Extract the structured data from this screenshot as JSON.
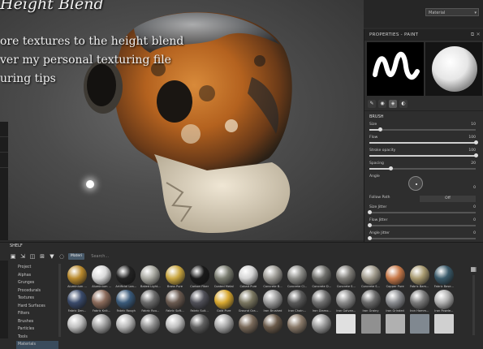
{
  "overlay": {
    "title": "Height Blend",
    "lines": [
      "ore textures to the height blend",
      "ver my personal texturing file",
      "uring tips"
    ]
  },
  "top_bar": {
    "viewport_mode": "Material"
  },
  "properties_panel": {
    "title": "PROPERTIES - PAINT",
    "section_title": "BRUSH",
    "params": [
      {
        "label": "Size",
        "value": "10",
        "fraction": 0.1
      },
      {
        "label": "Flow",
        "value": "100",
        "fraction": 1.0
      },
      {
        "label": "Stroke opacity",
        "value": "100",
        "fraction": 1.0
      },
      {
        "label": "Spacing",
        "value": "20",
        "fraction": 0.2
      }
    ],
    "angle_label": "Angle",
    "angle_value": "0",
    "follow_path_label": "Follow Path",
    "follow_path_value": "Off",
    "jitter_params": [
      {
        "label": "Size Jitter",
        "value": "0",
        "fraction": 0.0
      },
      {
        "label": "Flow Jitter",
        "value": "0",
        "fraction": 0.0
      },
      {
        "label": "Angle Jitter",
        "value": "0",
        "fraction": 0.0
      },
      {
        "label": "Position Jitter",
        "value": "0",
        "fraction": 0.0
      }
    ]
  },
  "shelf": {
    "title": "SHELF",
    "filter_tag": "Materi",
    "search_placeholder": "Search...",
    "categories": [
      {
        "label": "Project",
        "selected": false
      },
      {
        "label": "Alphas",
        "selected": false
      },
      {
        "label": "Grunges",
        "selected": false
      },
      {
        "label": "Procedurals",
        "selected": false
      },
      {
        "label": "Textures",
        "selected": false
      },
      {
        "label": "Hard Surfaces",
        "selected": false
      },
      {
        "label": "Filters",
        "selected": false
      },
      {
        "label": "Brushes",
        "selected": false
      },
      {
        "label": "Particles",
        "selected": false
      },
      {
        "label": "Tools",
        "selected": false
      },
      {
        "label": "Materials",
        "selected": true
      }
    ],
    "materials_row1": [
      {
        "label": "Aluminium ...",
        "color": "#b98a2e",
        "shape": "sphere"
      },
      {
        "label": "Aluminium ...",
        "color": "#d9d9d9",
        "shape": "sphere"
      },
      {
        "label": "Artificial Lea...",
        "color": "#222222",
        "shape": "sphere"
      },
      {
        "label": "Baked Light...",
        "color": "#a8a8a0",
        "shape": "sphere"
      },
      {
        "label": "Brass Pure",
        "color": "#c9a640",
        "shape": "sphere"
      },
      {
        "label": "Carbon Fiber",
        "color": "#1a1a1a",
        "shape": "sphere"
      },
      {
        "label": "Coated Metal",
        "color": "#7a7c70",
        "shape": "sphere"
      },
      {
        "label": "Cobalt Pure",
        "color": "#d4d4d4",
        "shape": "sphere"
      },
      {
        "label": "Concrete B...",
        "color": "#9c9a94",
        "shape": "sphere"
      },
      {
        "label": "Concrete Cl...",
        "color": "#8c8c88",
        "shape": "sphere"
      },
      {
        "label": "Concrete D...",
        "color": "#6e6e6a",
        "shape": "sphere"
      },
      {
        "label": "Concrete S...",
        "color": "#7f7d78",
        "shape": "sphere"
      },
      {
        "label": "Concrete S...",
        "color": "#a09a8c",
        "shape": "sphere"
      },
      {
        "label": "Copper Pure",
        "color": "#c87a4a",
        "shape": "sphere"
      },
      {
        "label": "Fabric Bam...",
        "color": "#a89a70",
        "shape": "sphere"
      },
      {
        "label": "Fabric Base...",
        "color": "#3a5a6a",
        "shape": "sphere"
      }
    ],
    "materials_row2": [
      {
        "label": "Fabric Den...",
        "color": "#3a4a6a",
        "shape": "sphere"
      },
      {
        "label": "Fabric Knit...",
        "color": "#8a6a5a",
        "shape": "sphere"
      },
      {
        "label": "Fabric Rough",
        "color": "#3a5a7a",
        "shape": "sphere"
      },
      {
        "label": "Fabric Rou...",
        "color": "#6a6a6a",
        "shape": "sphere"
      },
      {
        "label": "Fabric Soft...",
        "color": "#6a5a50",
        "shape": "sphere"
      },
      {
        "label": "Fabric Suit...",
        "color": "#505058",
        "shape": "sphere"
      },
      {
        "label": "Gold Pure",
        "color": "#d8a830",
        "shape": "sphere"
      },
      {
        "label": "Ground Gra...",
        "color": "#7a7660",
        "shape": "sphere"
      },
      {
        "label": "Iron Brushed",
        "color": "#9a9a9a",
        "shape": "sphere"
      },
      {
        "label": "Iron Chain...",
        "color": "#5a5a5a",
        "shape": "sphere"
      },
      {
        "label": "Iron Diamo...",
        "color": "#707070",
        "shape": "sphere"
      },
      {
        "label": "Iron Galvan...",
        "color": "#8a8a8a",
        "shape": "sphere"
      },
      {
        "label": "Iron Grainy",
        "color": "#6a6a6a",
        "shape": "sphere"
      },
      {
        "label": "Iron Grinded",
        "color": "#8a8c90",
        "shape": "sphere"
      },
      {
        "label": "Iron Hamm...",
        "color": "#7a7a7a",
        "shape": "sphere"
      },
      {
        "label": "Iron Powde...",
        "color": "#b0b0b0",
        "shape": "sphere"
      }
    ],
    "materials_row3": [
      {
        "label": "",
        "color": "#c0c0c0",
        "shape": "sphere"
      },
      {
        "label": "",
        "color": "#a0a0a0",
        "shape": "sphere"
      },
      {
        "label": "",
        "color": "#b8b8b8",
        "shape": "sphere"
      },
      {
        "label": "",
        "color": "#909090",
        "shape": "sphere"
      },
      {
        "label": "",
        "color": "#c0c0c0",
        "shape": "sphere"
      },
      {
        "label": "",
        "color": "#606060",
        "shape": "sphere"
      },
      {
        "label": "",
        "color": "#a8a8a8",
        "shape": "sphere"
      },
      {
        "label": "",
        "color": "#7a6a5a",
        "shape": "sphere"
      },
      {
        "label": "",
        "color": "#6a5a4a",
        "shape": "sphere"
      },
      {
        "label": "",
        "color": "#8a7a6a",
        "shape": "sphere"
      },
      {
        "label": "",
        "color": "#9a9a9a",
        "shape": "sphere"
      },
      {
        "label": "",
        "color": "#e0e0e0",
        "shape": "square"
      },
      {
        "label": "",
        "color": "#909090",
        "shape": "square"
      },
      {
        "label": "",
        "color": "#b0b0b0",
        "shape": "square"
      },
      {
        "label": "",
        "color": "#808890",
        "shape": "square"
      },
      {
        "label": "",
        "color": "#d0d0d0",
        "shape": "square"
      }
    ]
  }
}
